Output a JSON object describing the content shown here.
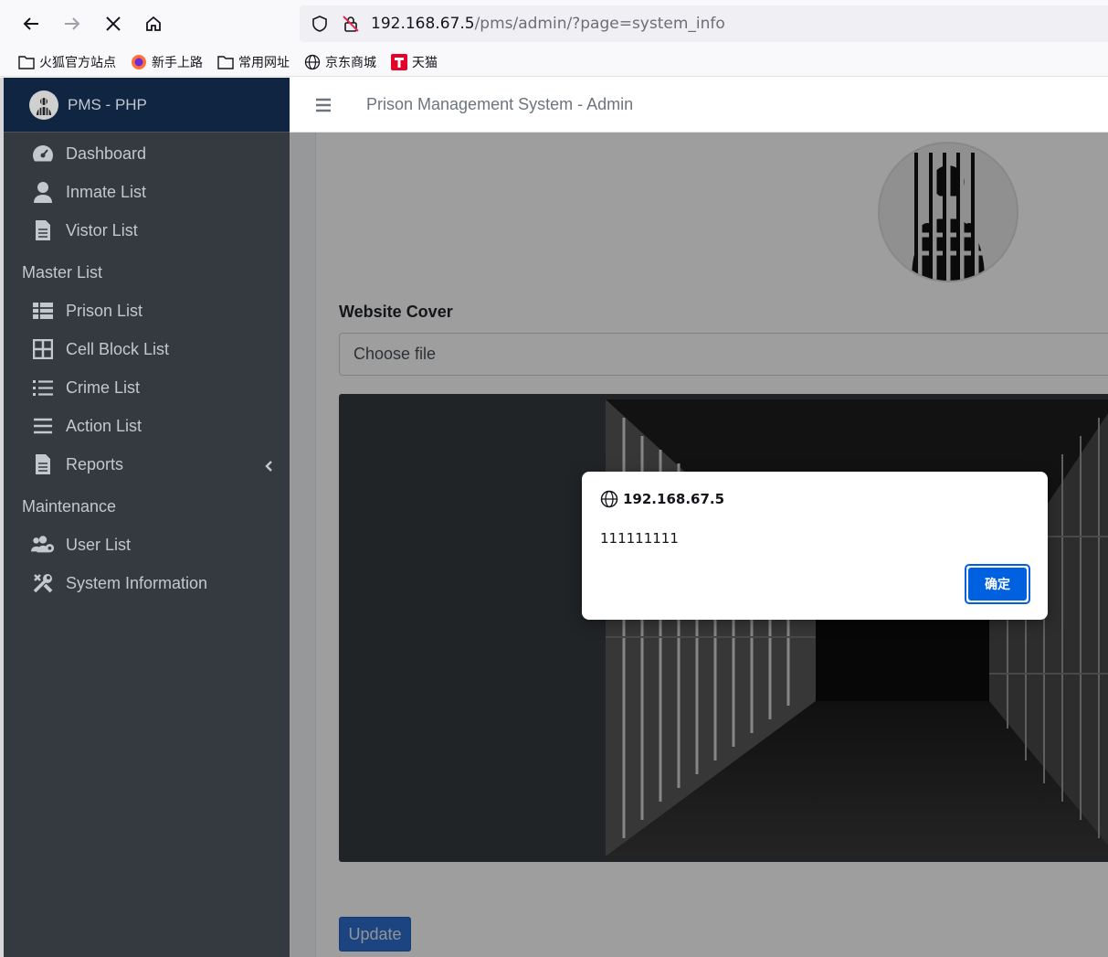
{
  "browser": {
    "url_host": "192.168.67.5",
    "url_path": "/pms/admin/?page=system_info",
    "bookmarks": [
      {
        "label": "火狐官方站点",
        "icon": "folder-icon"
      },
      {
        "label": "新手上路",
        "icon": "firefox-icon"
      },
      {
        "label": "常用网址",
        "icon": "folder-icon"
      },
      {
        "label": "京东商城",
        "icon": "globe-icon"
      },
      {
        "label": "天猫",
        "icon": "tmall-icon"
      }
    ]
  },
  "sidebar": {
    "brand": "PMS - PHP",
    "items": [
      {
        "label": "Dashboard",
        "icon": "dashboard-icon"
      },
      {
        "label": "Inmate List",
        "icon": "user-icon"
      },
      {
        "label": "Vistor List",
        "icon": "file-icon"
      }
    ],
    "master_header": "Master List",
    "master_items": [
      {
        "label": "Prison List",
        "icon": "table-icon"
      },
      {
        "label": "Cell Block List",
        "icon": "grid-icon"
      },
      {
        "label": "Crime List",
        "icon": "list-icon"
      },
      {
        "label": "Action List",
        "icon": "bars-icon"
      },
      {
        "label": "Reports",
        "icon": "file-icon"
      }
    ],
    "maintenance_header": "Maintenance",
    "maintenance_items": [
      {
        "label": "User List",
        "icon": "users-cog-icon"
      },
      {
        "label": "System Information",
        "icon": "tools-icon"
      }
    ]
  },
  "topbar": {
    "title": "Prison Management System - Admin"
  },
  "form": {
    "cover_label": "Website Cover",
    "file_placeholder": "Choose file",
    "update_label": "Update"
  },
  "alert": {
    "origin": "192.168.67.5",
    "message": "111111111",
    "ok_label": "确定"
  },
  "colors": {
    "sidebar_bg": "#343a40",
    "brand_bg": "#0f2541",
    "primary": "#2d6fd1",
    "alert_button": "#0061e0"
  }
}
